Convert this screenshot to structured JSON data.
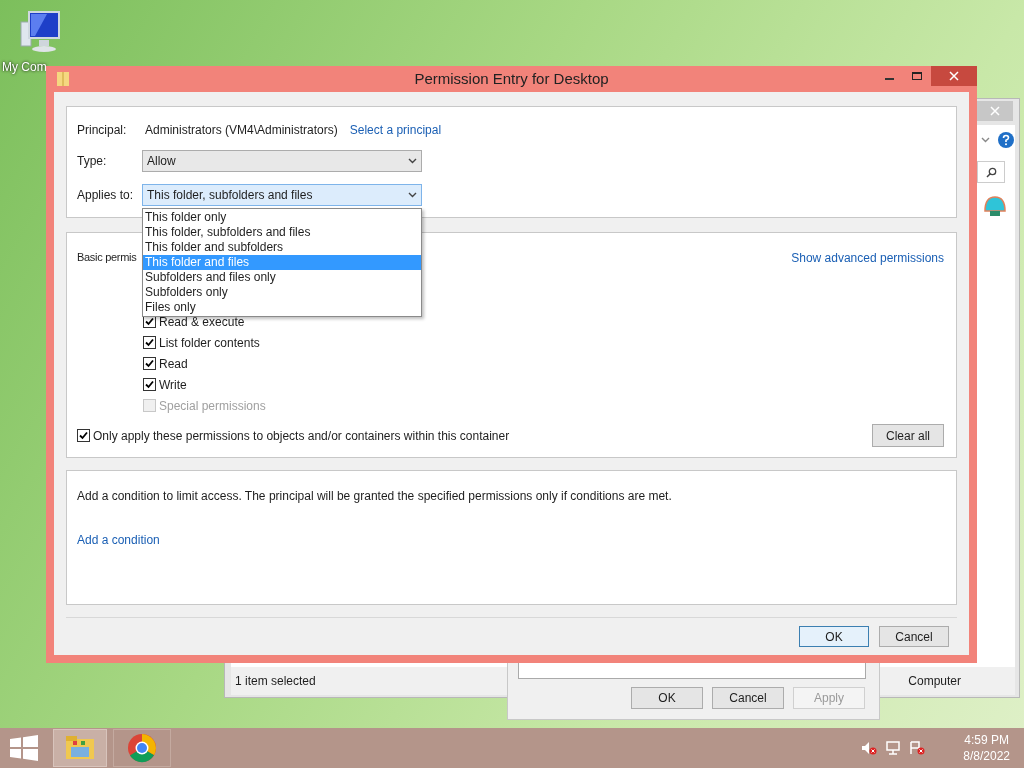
{
  "desktop_icons": [
    {
      "label": "My Com"
    }
  ],
  "explorer": {
    "status": "1 item selected",
    "location": "Computer"
  },
  "properties_dialog": {
    "buttons": [
      {
        "label": "OK",
        "disabled": false
      },
      {
        "label": "Cancel",
        "disabled": false
      },
      {
        "label": "Apply",
        "disabled": true
      }
    ]
  },
  "dialog": {
    "title": "Permission Entry for Desktop",
    "principal_label": "Principal:",
    "principal_value": "Administrators (VM4\\Administrators)",
    "select_principal": "Select a principal",
    "type_label": "Type:",
    "type_value": "Allow",
    "applies_label": "Applies to:",
    "applies_value": "This folder, subfolders and files",
    "applies_options": [
      {
        "label": "This folder only",
        "selected": false
      },
      {
        "label": "This folder, subfolders and files",
        "selected": false
      },
      {
        "label": "This folder and subfolders",
        "selected": false
      },
      {
        "label": "This folder and files",
        "selected": true
      },
      {
        "label": "Subfolders and files only",
        "selected": false
      },
      {
        "label": "Subfolders only",
        "selected": false
      },
      {
        "label": "Files only",
        "selected": false
      }
    ],
    "basic_permissions_label": "Basic permis",
    "show_advanced": "Show advanced permissions",
    "permissions": [
      {
        "label": "Read & execute",
        "checked": true,
        "disabled": false
      },
      {
        "label": "List folder contents",
        "checked": true,
        "disabled": false
      },
      {
        "label": "Read",
        "checked": true,
        "disabled": false
      },
      {
        "label": "Write",
        "checked": true,
        "disabled": false
      },
      {
        "label": "Special permissions",
        "checked": false,
        "disabled": true
      }
    ],
    "only_apply": {
      "label": "Only apply these permissions to objects and/or containers within this container",
      "checked": true
    },
    "clear_all": "Clear all",
    "condition_text": "Add a condition to limit access. The principal will be granted the specified permissions only if conditions are met.",
    "add_condition": "Add a condition",
    "buttons": [
      {
        "label": "OK",
        "default": true
      },
      {
        "label": "Cancel",
        "default": false
      }
    ]
  },
  "taskbar": {
    "time": "4:59 PM",
    "date": "8/8/2022"
  }
}
